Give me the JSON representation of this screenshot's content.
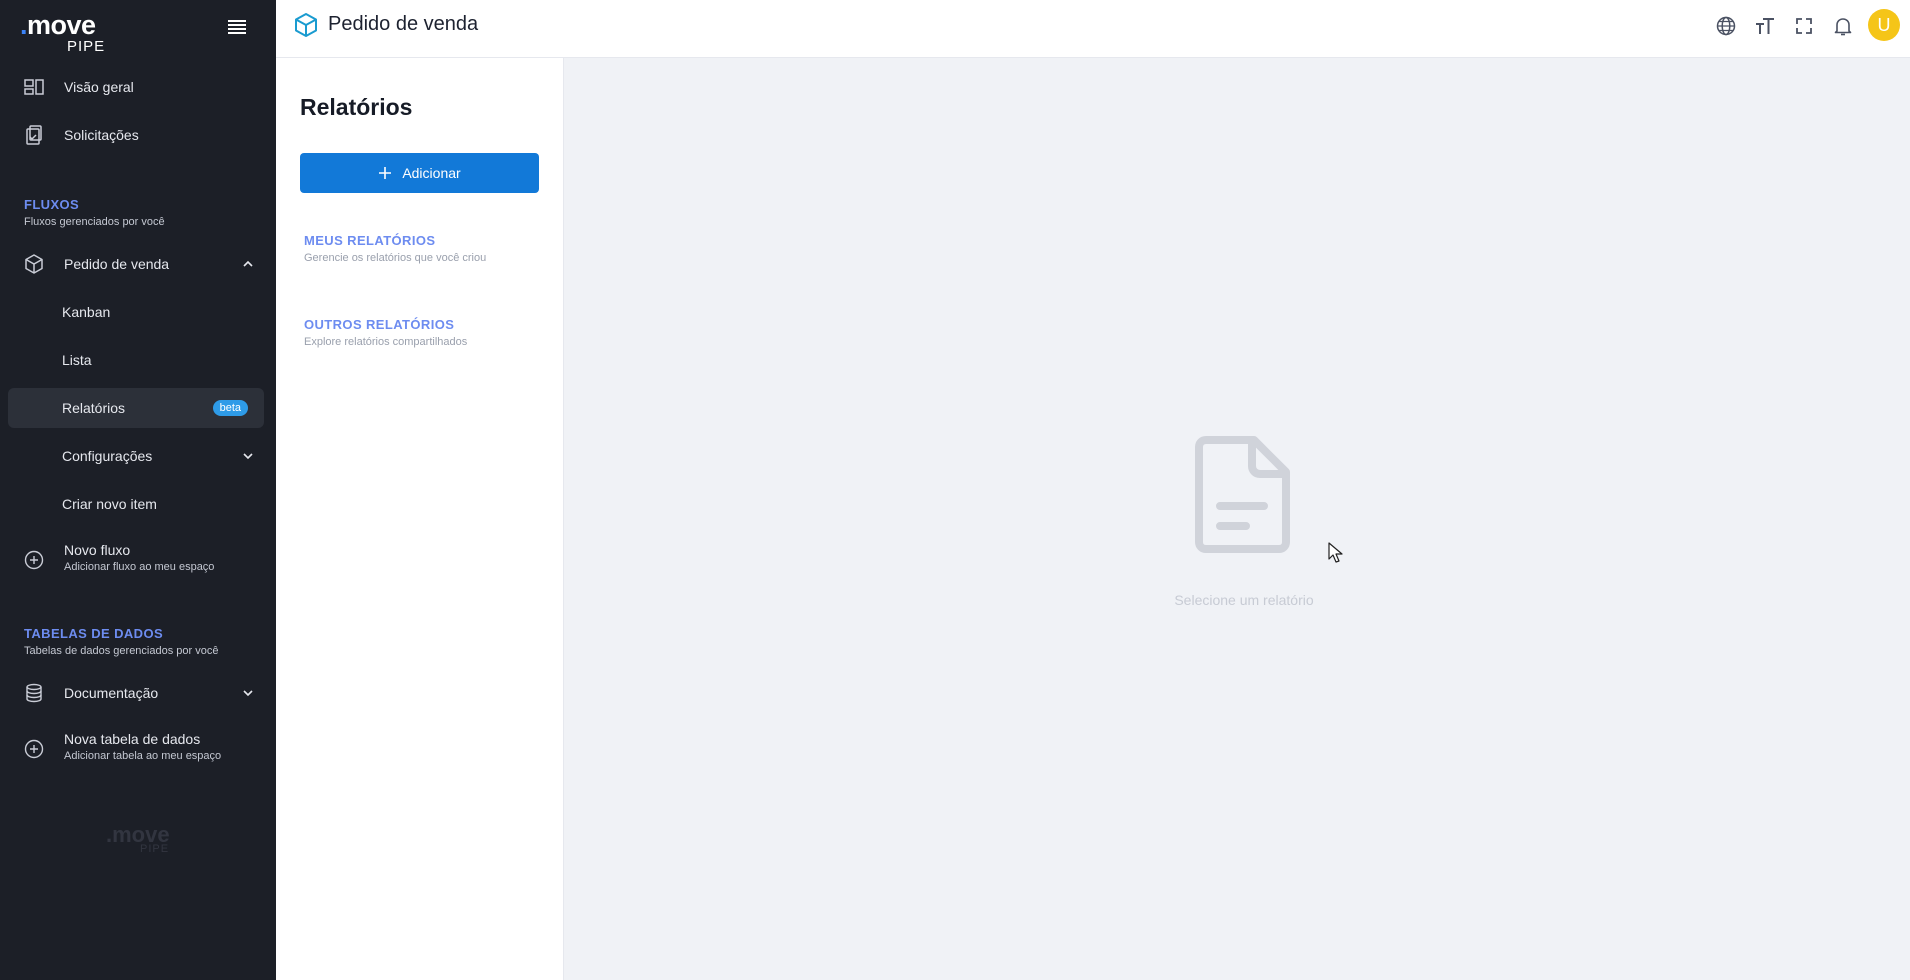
{
  "brand": {
    "name": "move",
    "sub": "PIPE"
  },
  "header": {
    "title": "Pedido de venda",
    "avatar_letter": "U",
    "icons": [
      "globe-icon",
      "text-size-icon",
      "fullscreen-icon",
      "bell-icon"
    ]
  },
  "sidebar": {
    "items": [
      {
        "label": "Visão geral",
        "icon": "overview-icon"
      },
      {
        "label": "Solicitações",
        "icon": "clipboard-icon"
      }
    ],
    "flows_section": {
      "title": "FLUXOS",
      "subtitle": "Fluxos gerenciados por você"
    },
    "flow": {
      "label": "Pedido de venda",
      "icon": "box-icon",
      "expanded": true,
      "children": [
        {
          "label": "Kanban"
        },
        {
          "label": "Lista"
        },
        {
          "label": "Relatórios",
          "badge": "beta",
          "active": true
        },
        {
          "label": "Configurações"
        },
        {
          "label": "Criar novo item"
        }
      ]
    },
    "new_flow": {
      "label": "Novo fluxo",
      "sublabel": "Adicionar fluxo ao meu espaço"
    },
    "tables_section": {
      "title": "TABELAS DE DADOS",
      "subtitle": "Tabelas de dados gerenciados por você"
    },
    "documentation": {
      "label": "Documentação",
      "icon": "database-icon"
    },
    "new_table": {
      "label": "Nova tabela de dados",
      "sublabel": "Adicionar tabela ao meu espaço"
    }
  },
  "reports": {
    "title": "Relatórios",
    "add_label": "Adicionar",
    "groups": [
      {
        "title": "MEUS RELATÓRIOS",
        "subtitle": "Gerencie os relatórios que você criou"
      },
      {
        "title": "OUTROS RELATÓRIOS",
        "subtitle": "Explore relatórios compartilhados"
      }
    ]
  },
  "main": {
    "empty_text": "Selecione um relatório"
  },
  "colors": {
    "sidebar_bg": "#1c1f27",
    "accent": "#1279d8",
    "section_title": "#6d8cf0",
    "badge": "#2e9be8",
    "avatar": "#f5c518"
  }
}
